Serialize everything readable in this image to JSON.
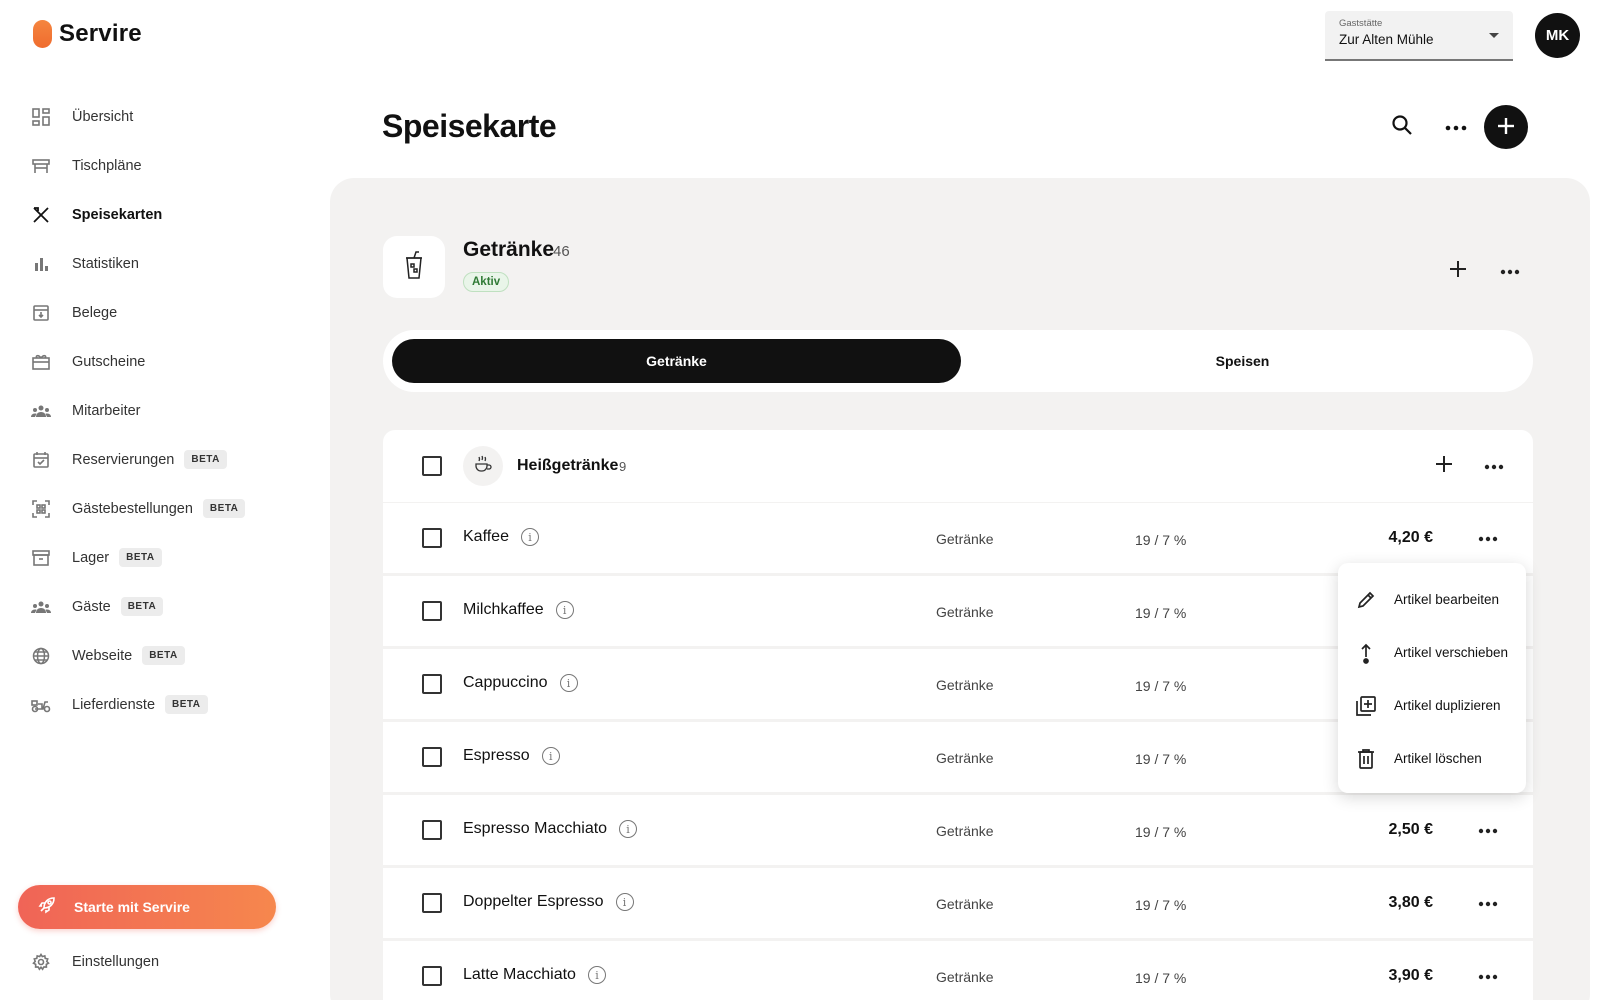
{
  "app": {
    "name": "Servire"
  },
  "sidebar": {
    "items": [
      {
        "label": "Übersicht",
        "icon": "dashboard-icon"
      },
      {
        "label": "Tischpläne",
        "icon": "table-icon"
      },
      {
        "label": "Speisekarten",
        "icon": "cutlery-icon",
        "active": true
      },
      {
        "label": "Statistiken",
        "icon": "bar-chart-icon"
      },
      {
        "label": "Belege",
        "icon": "receipt-icon"
      },
      {
        "label": "Gutscheine",
        "icon": "gift-icon"
      },
      {
        "label": "Mitarbeiter",
        "icon": "people-icon"
      },
      {
        "label": "Reservierungen",
        "icon": "calendar-icon",
        "badge": "BETA"
      },
      {
        "label": "Gästebestellungen",
        "icon": "qr-code-icon",
        "badge": "BETA"
      },
      {
        "label": "Lager",
        "icon": "archive-icon",
        "badge": "BETA"
      },
      {
        "label": "Gäste",
        "icon": "guests-icon",
        "badge": "BETA"
      },
      {
        "label": "Webseite",
        "icon": "globe-icon",
        "badge": "BETA"
      },
      {
        "label": "Lieferdienste",
        "icon": "scooter-icon",
        "badge": "BETA"
      }
    ],
    "cta_label": "Starte mit Servire",
    "settings_label": "Einstellungen"
  },
  "header": {
    "venue_caption": "Gaststätte",
    "venue_value": "Zur Alten Mühle",
    "avatar_initials": "MK",
    "page_title": "Speisekarte"
  },
  "menu": {
    "title": "Getränke",
    "count": "46",
    "status": "Aktiv",
    "tabs": [
      {
        "label": "Getränke",
        "active": true
      },
      {
        "label": "Speisen",
        "active": false
      }
    ]
  },
  "category": {
    "title": "Heißgetränke",
    "count": "9"
  },
  "items": [
    {
      "name": "Kaffee",
      "category": "Getränke",
      "tax": "19 / 7 %",
      "price": "4,20 €"
    },
    {
      "name": "Milchkaffee",
      "category": "Getränke",
      "tax": "19 / 7 %",
      "price": ""
    },
    {
      "name": "Cappuccino",
      "category": "Getränke",
      "tax": "19 / 7 %",
      "price": ""
    },
    {
      "name": "Espresso",
      "category": "Getränke",
      "tax": "19 / 7 %",
      "price": ""
    },
    {
      "name": "Espresso Macchiato",
      "category": "Getränke",
      "tax": "19 / 7 %",
      "price": "2,50 €"
    },
    {
      "name": "Doppelter Espresso",
      "category": "Getränke",
      "tax": "19 / 7 %",
      "price": "3,80 €"
    },
    {
      "name": "Latte Macchiato",
      "category": "Getränke",
      "tax": "19 / 7 %",
      "price": "3,90 €"
    }
  ],
  "context_menu": [
    {
      "label": "Artikel bearbeiten",
      "icon": "pencil-icon"
    },
    {
      "label": "Artikel verschieben",
      "icon": "move-up-icon"
    },
    {
      "label": "Artikel duplizieren",
      "icon": "duplicate-icon"
    },
    {
      "label": "Artikel löschen",
      "icon": "trash-icon"
    }
  ],
  "colors": {
    "accent_start": "#f06457",
    "accent_end": "#f6874d",
    "active_bg": "#111111",
    "badge_green": "#2f7a35"
  }
}
